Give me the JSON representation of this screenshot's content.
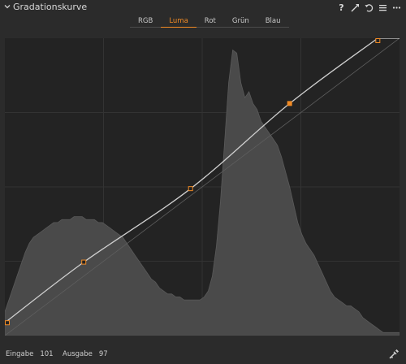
{
  "header": {
    "title": "Gradationskurve",
    "icons": [
      "help-icon",
      "auto-adjust-icon",
      "reset-icon",
      "menu-icon",
      "more-icon"
    ],
    "help_glyph": "?"
  },
  "tabs": [
    {
      "label": "RGB",
      "active": false
    },
    {
      "label": "Luma",
      "active": true
    },
    {
      "label": "Rot",
      "active": false
    },
    {
      "label": "Grün",
      "active": false
    },
    {
      "label": "Blau",
      "active": false
    }
  ],
  "curve": {
    "input_range": [
      0,
      255
    ],
    "output_range": [
      0,
      255
    ],
    "control_points": [
      {
        "in": 0,
        "out": 11,
        "selected": false
      },
      {
        "in": 51,
        "out": 63,
        "selected": false
      },
      {
        "in": 120,
        "out": 126,
        "selected": false
      },
      {
        "in": 184,
        "out": 199,
        "selected": true
      },
      {
        "in": 241,
        "out": 255,
        "selected": false
      }
    ],
    "histogram": [
      8,
      12,
      16,
      20,
      24,
      28,
      31,
      33,
      34,
      35,
      36,
      37,
      38,
      38,
      39,
      39,
      39,
      40,
      40,
      40,
      39,
      39,
      39,
      38,
      38,
      37,
      36,
      35,
      34,
      33,
      31,
      29,
      27,
      25,
      23,
      21,
      19,
      18,
      16,
      15,
      14,
      14,
      13,
      13,
      12,
      12,
      12,
      12,
      12,
      13,
      15,
      20,
      30,
      45,
      65,
      85,
      96,
      95,
      85,
      80,
      82,
      78,
      76,
      72,
      70,
      68,
      66,
      64,
      60,
      55,
      50,
      44,
      38,
      34,
      31,
      29,
      27,
      24,
      21,
      18,
      15,
      13,
      12,
      11,
      10,
      10,
      9,
      8,
      6,
      5,
      4,
      3,
      2,
      1,
      1,
      1,
      1,
      1
    ],
    "colors": {
      "accent": "#f08a24",
      "curve_line": "#cfcfcf",
      "histogram_fill": "#4a4a4a",
      "grid": "#333333",
      "background": "#232323"
    }
  },
  "footer": {
    "input_label": "Eingabe",
    "input_value": "101",
    "output_label": "Ausgabe",
    "output_value": "97",
    "picker_icon": "eyedropper-icon"
  }
}
